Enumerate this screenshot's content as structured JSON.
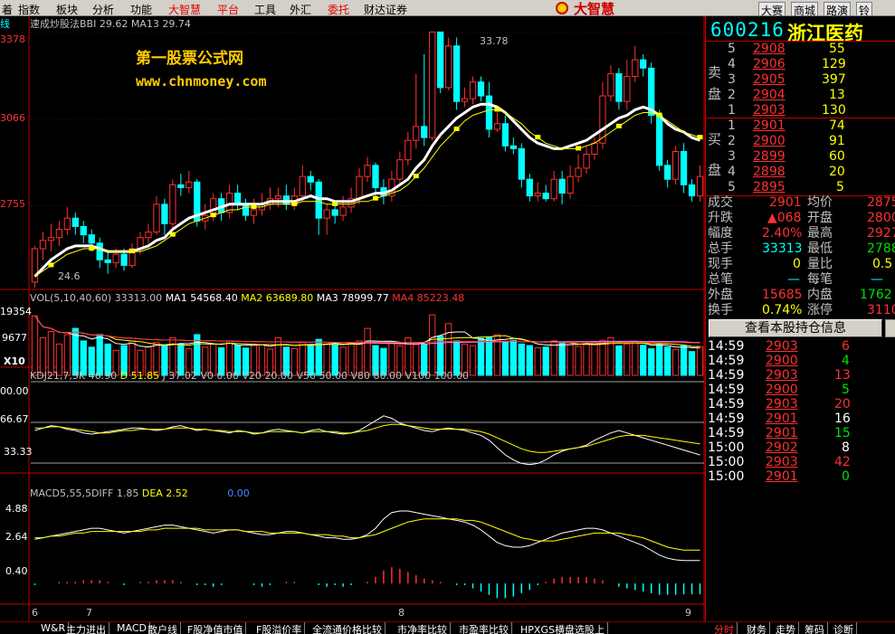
{
  "menu": {
    "items": [
      "着",
      "指数",
      "板块",
      "分析",
      "功能",
      "大智慧",
      "平台",
      "工具",
      "外汇",
      "委托",
      "财达证券"
    ],
    "logo": "大智慧",
    "right_buttons": [
      "大赛",
      "商城",
      "路演",
      "铃"
    ]
  },
  "chart": {
    "main_label": "线",
    "indicator_line": "速成炒股法BBI 29.62 MA13 29.74",
    "watermark_title": "第一股票公式网",
    "watermark_url": "www.chnmoney.com",
    "price_ticks": [
      "33.78",
      "3066",
      "2755",
      "3378"
    ],
    "high_label": "33.78",
    "low_label": "24.6",
    "vol_line": [
      "VOL(5,10,40,60)",
      "33313.00",
      "MA1",
      "54568.40",
      "MA2",
      "63689.80",
      "MA3",
      "78999.77",
      "MA4",
      "85223.48"
    ],
    "vol_ticks": [
      "19354",
      "9677",
      "X10"
    ],
    "kdj_line": [
      "KDJ21,7,3K",
      "46.90",
      "D",
      "51.85",
      "J",
      "37.02",
      "V0",
      "0.00",
      "V20",
      "20.00",
      "V50",
      "50.00",
      "V80",
      "80.00",
      "V100",
      "100.00"
    ],
    "kdj_ticks": [
      "00.00",
      "66.67",
      "33.33"
    ],
    "macd_line": [
      "MACD5,55,5DIFF",
      "1.85",
      "DEA",
      "2.52",
      "0.00"
    ],
    "macd_ticks": [
      "4.88",
      "2.64",
      "0.40"
    ],
    "date_ticks": [
      "6",
      "7",
      "8",
      "9"
    ]
  },
  "colors": {
    "up": "#ff3030",
    "down": "#00ffff",
    "ma1": "#ffffff",
    "ma2": "#ffff00",
    "grid": "#c00000"
  },
  "chart_data": {
    "type": "candlestick",
    "price_scale": {
      "min": 24.6,
      "max": 33.78,
      "ticks": [
        27.55,
        30.66,
        33.78
      ]
    },
    "candles": [
      [
        24.8,
        26.0,
        24.6,
        26.1
      ],
      [
        26.0,
        26.3,
        25.6,
        26.6
      ],
      [
        26.3,
        26.4,
        25.9,
        26.9
      ],
      [
        26.4,
        26.7,
        26.1,
        27.0
      ],
      [
        26.7,
        27.1,
        26.5,
        27.5
      ],
      [
        27.1,
        26.8,
        26.5,
        27.3
      ],
      [
        26.8,
        26.5,
        26.2,
        27.0
      ],
      [
        26.5,
        26.2,
        25.9,
        26.7
      ],
      [
        26.2,
        25.6,
        25.3,
        26.4
      ],
      [
        25.6,
        25.5,
        25.1,
        25.9
      ],
      [
        25.5,
        25.8,
        25.3,
        26.0
      ],
      [
        25.8,
        25.4,
        25.2,
        26.0
      ],
      [
        25.4,
        26.0,
        25.3,
        26.2
      ],
      [
        26.0,
        26.4,
        25.8,
        26.6
      ],
      [
        26.4,
        26.6,
        26.2,
        26.9
      ],
      [
        26.6,
        27.6,
        26.5,
        27.9
      ],
      [
        27.6,
        26.9,
        26.5,
        27.8
      ],
      [
        26.9,
        28.3,
        26.7,
        28.5
      ],
      [
        28.3,
        28.2,
        27.9,
        28.7
      ],
      [
        28.2,
        28.4,
        28.0,
        28.8
      ],
      [
        28.4,
        27.0,
        26.8,
        28.5
      ],
      [
        27.0,
        27.2,
        26.7,
        27.6
      ],
      [
        27.2,
        27.8,
        27.0,
        28.0
      ],
      [
        27.8,
        27.3,
        27.0,
        28.0
      ],
      [
        27.3,
        28.0,
        27.1,
        28.3
      ],
      [
        28.0,
        27.6,
        27.4,
        28.3
      ],
      [
        27.6,
        27.2,
        27.0,
        27.8
      ],
      [
        27.2,
        27.4,
        26.9,
        27.8
      ],
      [
        27.4,
        27.6,
        27.2,
        28.0
      ],
      [
        27.6,
        27.8,
        27.4,
        28.2
      ],
      [
        27.8,
        27.9,
        27.5,
        28.2
      ],
      [
        27.9,
        27.6,
        27.4,
        28.3
      ],
      [
        27.6,
        27.9,
        27.4,
        28.2
      ],
      [
        27.9,
        28.6,
        27.7,
        29.0
      ],
      [
        28.6,
        28.4,
        28.1,
        28.8
      ],
      [
        28.4,
        27.1,
        26.5,
        28.5
      ],
      [
        27.1,
        27.4,
        26.5,
        27.6
      ],
      [
        27.4,
        27.2,
        26.9,
        27.7
      ],
      [
        27.2,
        27.5,
        27.0,
        27.9
      ],
      [
        27.5,
        27.8,
        27.3,
        28.2
      ],
      [
        27.8,
        28.6,
        27.6,
        28.9
      ],
      [
        28.6,
        29.0,
        28.4,
        29.3
      ],
      [
        29.0,
        28.2,
        27.9,
        29.1
      ],
      [
        28.2,
        27.9,
        27.6,
        28.5
      ],
      [
        27.9,
        28.5,
        27.7,
        28.8
      ],
      [
        28.5,
        29.2,
        28.3,
        29.5
      ],
      [
        29.2,
        29.9,
        29.0,
        30.2
      ],
      [
        29.9,
        30.4,
        29.6,
        32.3
      ],
      [
        30.4,
        30.0,
        29.7,
        33.0
      ],
      [
        30.0,
        33.8,
        29.9,
        33.8
      ],
      [
        33.8,
        31.8,
        31.6,
        33.8
      ],
      [
        31.8,
        33.3,
        31.7,
        33.6
      ],
      [
        33.3,
        31.3,
        31.0,
        33.6
      ],
      [
        31.3,
        31.4,
        31.1,
        31.8
      ],
      [
        31.4,
        32.0,
        31.2,
        32.2
      ],
      [
        32.0,
        31.5,
        31.3,
        32.2
      ],
      [
        31.5,
        30.3,
        30.0,
        32.0
      ],
      [
        30.3,
        30.5,
        30.2,
        30.9
      ],
      [
        30.5,
        29.7,
        29.5,
        30.8
      ],
      [
        29.7,
        29.6,
        29.4,
        30.0
      ],
      [
        29.6,
        28.5,
        28.2,
        29.8
      ],
      [
        28.5,
        27.9,
        27.7,
        28.7
      ],
      [
        27.9,
        28.0,
        27.7,
        28.4
      ],
      [
        28.0,
        27.8,
        27.7,
        28.3
      ],
      [
        27.8,
        28.5,
        27.7,
        28.8
      ],
      [
        28.5,
        28.0,
        27.6,
        28.8
      ],
      [
        28.0,
        28.6,
        27.8,
        29.0
      ],
      [
        28.6,
        28.9,
        28.4,
        29.4
      ],
      [
        28.9,
        29.4,
        28.7,
        29.7
      ],
      [
        29.4,
        29.8,
        29.2,
        30.0
      ],
      [
        29.8,
        31.5,
        29.6,
        32.0
      ],
      [
        31.5,
        32.3,
        31.3,
        32.6
      ],
      [
        32.3,
        31.3,
        31.0,
        32.5
      ],
      [
        31.3,
        32.2,
        31.0,
        32.8
      ],
      [
        32.2,
        32.8,
        32.0,
        33.3
      ],
      [
        32.8,
        32.5,
        32.2,
        33.0
      ],
      [
        32.5,
        30.8,
        30.5,
        32.7
      ],
      [
        30.8,
        29.0,
        28.8,
        31.0
      ],
      [
        29.0,
        28.5,
        28.2,
        29.2
      ],
      [
        28.5,
        29.5,
        28.3,
        29.7
      ],
      [
        29.5,
        28.3,
        28.0,
        29.8
      ],
      [
        28.3,
        27.9,
        27.7,
        28.5
      ],
      [
        27.9,
        28.6,
        27.7,
        29.0
      ]
    ],
    "bbi": [
      25.0,
      25.3,
      25.6,
      25.8,
      26.0,
      26.1,
      26.1,
      26.1,
      26.0,
      25.9,
      25.9,
      25.9,
      25.9,
      26.0,
      26.1,
      26.3,
      26.4,
      26.7,
      26.9,
      27.1,
      27.2,
      27.3,
      27.4,
      27.5,
      27.6,
      27.6,
      27.6,
      27.6,
      27.6,
      27.7,
      27.7,
      27.7,
      27.7,
      27.8,
      27.9,
      27.8,
      27.8,
      27.7,
      27.7,
      27.7,
      27.8,
      27.9,
      28.0,
      28.0,
      28.1,
      28.3,
      28.5,
      28.9,
      29.2,
      29.7,
      30.1,
      30.4,
      30.7,
      30.9,
      31.1,
      31.2,
      31.2,
      31.1,
      30.9,
      30.6,
      30.3,
      30.0,
      29.8,
      29.7,
      29.6,
      29.6,
      29.7,
      29.8,
      29.9,
      30.1,
      30.3,
      30.5,
      30.7,
      30.8,
      31.0,
      31.1,
      31.0,
      30.8,
      30.5,
      30.3,
      30.2,
      30.0,
      29.9
    ],
    "ma13": [
      25.0,
      25.2,
      25.4,
      25.6,
      25.8,
      25.9,
      26.0,
      26.0,
      26.0,
      25.9,
      25.9,
      25.9,
      25.9,
      25.9,
      26.0,
      26.1,
      26.3,
      26.5,
      26.7,
      26.9,
      27.0,
      27.1,
      27.2,
      27.3,
      27.4,
      27.4,
      27.5,
      27.5,
      27.5,
      27.6,
      27.6,
      27.6,
      27.6,
      27.7,
      27.7,
      27.7,
      27.6,
      27.6,
      27.6,
      27.6,
      27.7,
      27.7,
      27.8,
      27.9,
      28.0,
      28.1,
      28.3,
      28.6,
      28.9,
      29.3,
      29.7,
      30.0,
      30.3,
      30.6,
      30.8,
      30.9,
      31.0,
      31.0,
      30.9,
      30.7,
      30.5,
      30.2,
      30.0,
      29.8,
      29.7,
      29.6,
      29.6,
      29.6,
      29.7,
      29.8,
      30.0,
      30.2,
      30.4,
      30.6,
      30.8,
      30.9,
      30.9,
      30.8,
      30.6,
      30.4,
      30.2,
      30.1,
      30.0
    ],
    "volume": [
      19000,
      12000,
      14000,
      10000,
      13000,
      15000,
      11000,
      9000,
      13000,
      10000,
      8000,
      9500,
      11000,
      8000,
      9000,
      10500,
      9500,
      12000,
      10000,
      8500,
      13000,
      9000,
      10000,
      8800,
      11000,
      9500,
      8700,
      10000,
      9800,
      8400,
      12000,
      9000,
      8500,
      10500,
      9500,
      11500,
      10000,
      9800,
      9000,
      10200,
      11000,
      15000,
      9500,
      8600,
      10300,
      9400,
      12000,
      9800,
      10000,
      19354,
      12500,
      16500,
      11000,
      10000,
      9500,
      11800,
      12300,
      13000,
      10800,
      11200,
      10000,
      9500,
      8800,
      9000,
      11000,
      10500,
      9800,
      9200,
      10000,
      10500,
      11200,
      12000,
      9400,
      10000,
      10800,
      9600,
      8500,
      9800,
      9000,
      8200,
      9600,
      7600,
      9100
    ],
    "vol_scale": {
      "min": 0,
      "max": 19354,
      "mid": 9677
    },
    "kdj_k": [
      60,
      62,
      64,
      63,
      61,
      60,
      58,
      57,
      58,
      59,
      60,
      61,
      62,
      62,
      61,
      60,
      61,
      63,
      64,
      62,
      60,
      61,
      60,
      59,
      58,
      60,
      59,
      57,
      58,
      60,
      61,
      60,
      59,
      58,
      60,
      61,
      59,
      58,
      57,
      58,
      60,
      64,
      68,
      72,
      70,
      66,
      64,
      62,
      60,
      59,
      61,
      62,
      61,
      60,
      58,
      56,
      52,
      46,
      40,
      36,
      33,
      32,
      33,
      36,
      40,
      43,
      45,
      46,
      48,
      52,
      55,
      58,
      60,
      58,
      56,
      54,
      52,
      50,
      48,
      46,
      44,
      42,
      40
    ],
    "kdj_d": [
      62,
      62,
      63,
      63,
      62,
      61,
      60,
      59,
      58,
      58,
      59,
      60,
      60,
      61,
      61,
      61,
      61,
      62,
      62,
      62,
      61,
      61,
      60,
      60,
      59,
      59,
      59,
      58,
      58,
      59,
      59,
      59,
      59,
      58,
      59,
      59,
      59,
      59,
      58,
      58,
      59,
      60,
      62,
      64,
      65,
      65,
      64,
      63,
      62,
      61,
      61,
      61,
      61,
      61,
      60,
      59,
      57,
      54,
      51,
      48,
      45,
      43,
      42,
      42,
      43,
      44,
      45,
      46,
      47,
      49,
      51,
      53,
      55,
      56,
      56,
      56,
      55,
      54,
      53,
      52,
      51,
      50,
      49
    ],
    "kdj_scale": {
      "min": 33.33,
      "max": 100
    },
    "macd_diff": [
      3.2,
      3.3,
      3.4,
      3.5,
      3.6,
      3.7,
      3.8,
      3.9,
      3.9,
      3.8,
      3.7,
      3.6,
      3.7,
      3.8,
      3.9,
      4.0,
      4.1,
      4.1,
      4.0,
      3.9,
      3.8,
      3.7,
      3.6,
      3.7,
      3.8,
      3.8,
      3.7,
      3.6,
      3.5,
      3.5,
      3.6,
      3.7,
      3.7,
      3.6,
      3.5,
      3.4,
      3.3,
      3.3,
      3.2,
      3.2,
      3.3,
      3.5,
      3.9,
      4.5,
      4.9,
      5.0,
      5.0,
      4.9,
      4.8,
      4.7,
      4.6,
      4.5,
      4.4,
      4.3,
      4.1,
      3.8,
      3.4,
      3.0,
      2.8,
      2.7,
      2.7,
      2.8,
      3.0,
      3.2,
      3.4,
      3.6,
      3.7,
      3.8,
      3.9,
      3.9,
      3.8,
      3.6,
      3.4,
      3.2,
      3.0,
      2.8,
      2.5,
      2.2,
      2.0,
      1.9,
      1.85,
      1.85,
      1.85
    ],
    "macd_dea": [
      3.3,
      3.3,
      3.4,
      3.4,
      3.5,
      3.6,
      3.6,
      3.7,
      3.7,
      3.7,
      3.7,
      3.7,
      3.7,
      3.7,
      3.8,
      3.8,
      3.9,
      3.9,
      3.9,
      3.9,
      3.9,
      3.8,
      3.8,
      3.8,
      3.8,
      3.8,
      3.7,
      3.7,
      3.7,
      3.6,
      3.6,
      3.6,
      3.6,
      3.6,
      3.5,
      3.5,
      3.5,
      3.4,
      3.4,
      3.3,
      3.3,
      3.4,
      3.5,
      3.7,
      3.9,
      4.1,
      4.3,
      4.4,
      4.5,
      4.5,
      4.5,
      4.5,
      4.5,
      4.4,
      4.4,
      4.3,
      4.1,
      3.9,
      3.7,
      3.5,
      3.3,
      3.2,
      3.1,
      3.1,
      3.1,
      3.2,
      3.3,
      3.4,
      3.5,
      3.6,
      3.6,
      3.6,
      3.6,
      3.5,
      3.4,
      3.3,
      3.1,
      2.9,
      2.7,
      2.6,
      2.52,
      2.52,
      2.52
    ],
    "macd_scale": {
      "min": -0.8,
      "max": 5.4,
      "ticks": [
        0.4,
        2.64,
        4.88
      ]
    }
  },
  "side": {
    "code": "600216",
    "name": "浙江医药",
    "sell_label": [
      "卖",
      "盘"
    ],
    "buy_label": [
      "买",
      "盘"
    ],
    "sell": [
      [
        "5",
        "2908",
        "55"
      ],
      [
        "4",
        "2906",
        "129"
      ],
      [
        "3",
        "2905",
        "397"
      ],
      [
        "2",
        "2904",
        "13"
      ],
      [
        "1",
        "2903",
        "130"
      ]
    ],
    "buy": [
      [
        "1",
        "2901",
        "74"
      ],
      [
        "2",
        "2900",
        "91"
      ],
      [
        "3",
        "2899",
        "60"
      ],
      [
        "4",
        "2898",
        "20"
      ],
      [
        "5",
        "2895",
        "5"
      ]
    ],
    "stats": [
      [
        "成交",
        "2901",
        "均价",
        "2875"
      ],
      [
        "升跌",
        "▲068",
        "开盘",
        "2800"
      ],
      [
        "幅度",
        "2.40%",
        "最高",
        "2927"
      ],
      [
        "总手",
        "33313",
        "最低",
        "2788"
      ],
      [
        "现手",
        "0",
        "量比",
        "0.5"
      ],
      [
        "总笔",
        "—",
        "每笔",
        "—"
      ],
      [
        "外盘",
        "15685",
        "内盘",
        "1762"
      ],
      [
        "换手",
        "0.74%",
        "涨停",
        "3110"
      ]
    ],
    "holdings_button": "查看本股持仓信息",
    "ticks": [
      [
        "14:59",
        "2903",
        "6",
        "rd"
      ],
      [
        "14:59",
        "2900",
        "4",
        "gr"
      ],
      [
        "14:59",
        "2903",
        "13",
        "rd"
      ],
      [
        "14:59",
        "2900",
        "5",
        "gr"
      ],
      [
        "14:59",
        "2903",
        "20",
        "rd"
      ],
      [
        "14:59",
        "2901",
        "16",
        "wh"
      ],
      [
        "14:59",
        "2901",
        "15",
        "gr"
      ],
      [
        "15:00",
        "2902",
        "8",
        "wh"
      ],
      [
        "15:00",
        "2903",
        "42",
        "rd"
      ],
      [
        "15:00",
        "2901",
        "0",
        "gr"
      ]
    ]
  },
  "bottom": {
    "tabs": [
      "W&R",
      "主力进出",
      "MACD",
      "散户线",
      "F股净值市值",
      "F股溢价率",
      "全流通价格比较",
      "市净率比较",
      "市盈率比较",
      "HPXGS横盘选股上"
    ],
    "right_tabs": [
      "分时",
      "财务",
      "走势",
      "筹码",
      "诊断"
    ]
  }
}
